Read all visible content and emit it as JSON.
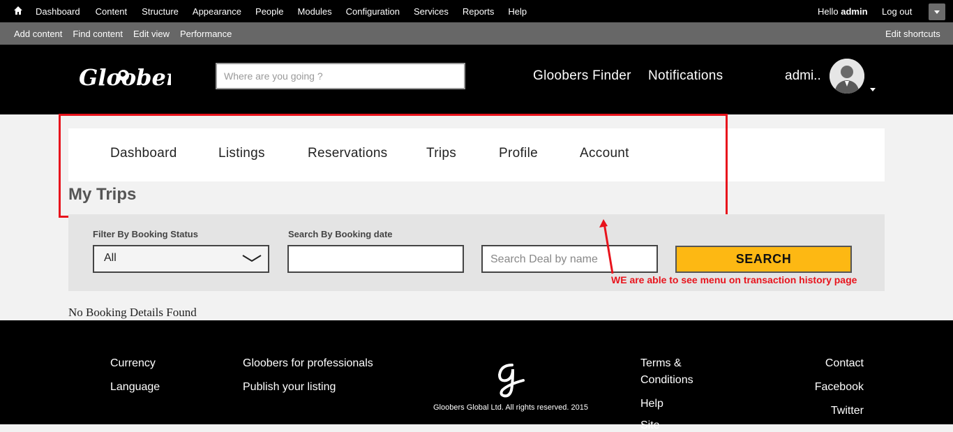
{
  "admin_bar": {
    "menu": [
      "Dashboard",
      "Content",
      "Structure",
      "Appearance",
      "People",
      "Modules",
      "Configuration",
      "Services",
      "Reports",
      "Help"
    ],
    "hello_prefix": "Hello",
    "user": "admin",
    "logout": "Log out"
  },
  "shortcuts": {
    "links": [
      "Add content",
      "Find content",
      "Edit view",
      "Performance"
    ],
    "edit": "Edit shortcuts"
  },
  "header": {
    "logo_text": "Gloobers",
    "search_placeholder": "Where are you going ?",
    "finder": "Gloobers Finder",
    "notifications": "Notifications",
    "user_short": "admi.."
  },
  "tabs": [
    "Dashboard",
    "Listings",
    "Reservations",
    "Trips",
    "Profile",
    "Account"
  ],
  "page_title": "My Trips",
  "filters": {
    "status_label": "Filter By Booking Status",
    "status_value": "All",
    "date_label": "Search By Booking date",
    "date_value": "",
    "deal_placeholder": "Search Deal by name",
    "search_button": "SEARCH"
  },
  "annotation": "WE are able to see menu on transaction history page",
  "empty_message": "No Booking Details Found",
  "footer": {
    "col1": [
      "Currency",
      "Language"
    ],
    "col2": [
      "Gloobers for professionals",
      "Publish your listing"
    ],
    "col3": [
      "Terms &",
      "Conditions",
      "Help",
      "Site"
    ],
    "col4": [
      "Contact",
      "Facebook",
      "Twitter"
    ],
    "copyright": "Gloobers Global Ltd. All rights reserved. 2015"
  },
  "colors": {
    "accent": "#fdb813",
    "annotation_red": "#e8131c",
    "header_bg": "#000000"
  }
}
